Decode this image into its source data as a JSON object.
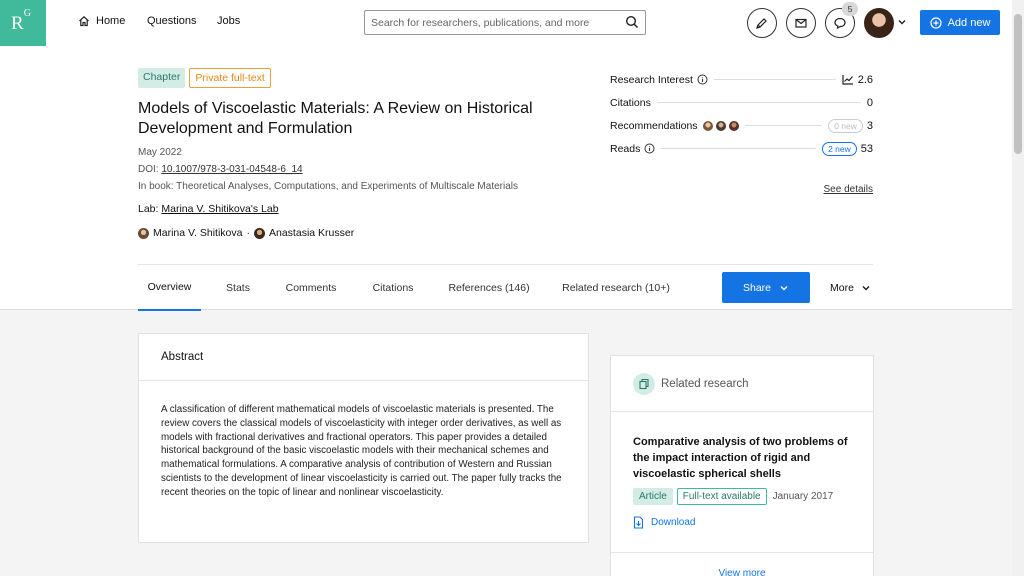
{
  "brand": {
    "logo_text": "R",
    "logo_sup": "G",
    "accent": "#40ba9b",
    "primary": "#1474e4"
  },
  "nav": {
    "home": "Home",
    "questions": "Questions",
    "jobs": "Jobs",
    "search_placeholder": "Search for researchers, publications, and more",
    "notifications_count": "5",
    "add_new": "Add new"
  },
  "publication": {
    "type_badge": "Chapter",
    "access_badge": "Private full-text",
    "title": "Models of Viscoelastic Materials: A Review on Historical Development and Formulation",
    "date": "May 2022",
    "doi_label": "DOI:",
    "doi": "10.1007/978-3-031-04548-6_14",
    "book": "In book: Theoretical Analyses, Computations, and Experiments of Multiscale Materials",
    "lab_label": "Lab:",
    "lab": "Marina V. Shitikova's Lab",
    "authors": [
      "Marina V. Shitikova",
      "Anastasia Krusser"
    ],
    "author_separator": "·"
  },
  "stats": {
    "research_interest": {
      "label": "Research Interest",
      "value": "2.6"
    },
    "citations": {
      "label": "Citations",
      "value": "0"
    },
    "recommendations": {
      "label": "Recommendations",
      "new": "0 new",
      "value": "3"
    },
    "reads": {
      "label": "Reads",
      "new": "2 new",
      "value": "53"
    },
    "see_details": "See details"
  },
  "tabs": [
    {
      "label": "Overview",
      "active": true
    },
    {
      "label": "Stats"
    },
    {
      "label": "Comments"
    },
    {
      "label": "Citations"
    },
    {
      "label": "References (146)"
    },
    {
      "label": "Related research (10+)"
    }
  ],
  "actions": {
    "share": "Share",
    "more": "More"
  },
  "abstract": {
    "heading": "Abstract",
    "text": "A classification of different mathematical models of viscoelastic materials is presented. The review covers the classical models of viscoelasticity with integer order derivatives, as well as models with fractional derivatives and fractional operators. This paper provides a detailed historical background of the basic viscoelastic models with their mechanical schemes and mathematical formulations. A comparative analysis of contribution of Western and Russian scientists to the development of linear viscoelasticity is carried out. The paper fully tracks the recent theories on the topic of linear and nonlinear viscoelasticity."
  },
  "related": {
    "heading": "Related research",
    "item": {
      "title": "Comparative analysis of two problems of the impact interaction of rigid and viscoelastic spherical shells",
      "type": "Article",
      "access": "Full-text available",
      "date": "January 2017",
      "download": "Download"
    },
    "view_more": "View more"
  }
}
